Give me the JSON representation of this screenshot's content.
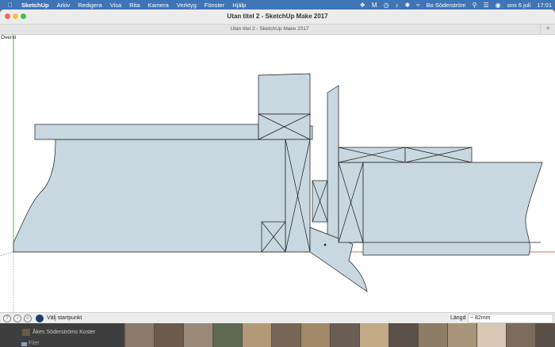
{
  "menubar": {
    "app_name": "SketchUp",
    "items": [
      "Arkiv",
      "Redigera",
      "Visa",
      "Rita",
      "Kamera",
      "Verktyg",
      "Fönster",
      "Hjälp"
    ],
    "user_name": "Bo Söderström",
    "date": "ons 6 juli",
    "time": "17:01",
    "status_icons": [
      "dropbox-icon",
      "mail-icon",
      "time-machine-icon",
      "volume-icon",
      "bluetooth-icon",
      "wifi-icon",
      "search-icon",
      "control-center-icon",
      "siri-icon"
    ]
  },
  "window": {
    "title": "Utan titel 2 - SketchUp Make 2017",
    "tab_title": "Utan titel 2 - SketchUp Make 2017",
    "new_tab": "+"
  },
  "viewport": {
    "view_label": "Överst",
    "face_color": "#c8d7e0",
    "edge_color": "#1a1a1a"
  },
  "statusbar": {
    "text": "Välj startpunkt",
    "measure_label": "Längd",
    "measure_value": "~ 82mm"
  },
  "desktop": {
    "finder_items": [
      "Åkes Söderströms Koster",
      "Filer"
    ]
  }
}
